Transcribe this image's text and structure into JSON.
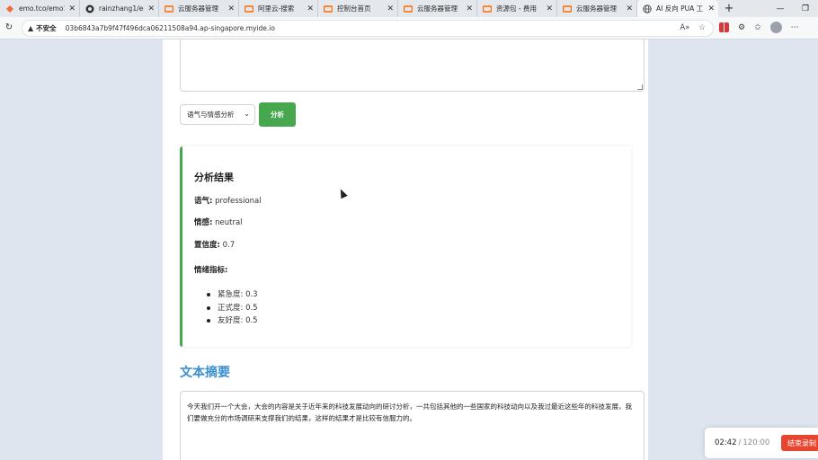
{
  "browser": {
    "tabs": [
      {
        "title": "emo.tco/emo1",
        "icon": "orange-favicon-icon"
      },
      {
        "title": "rainzhang1/em",
        "icon": "github-icon"
      },
      {
        "title": "云服务器管理",
        "icon": "aliyun-icon"
      },
      {
        "title": "阿里云-搜索",
        "icon": "aliyun-icon"
      },
      {
        "title": "控制台首页",
        "icon": "aliyun-icon"
      },
      {
        "title": "云服务器管理",
        "icon": "aliyun-icon"
      },
      {
        "title": "资源包 - 费用",
        "icon": "aliyun-icon"
      },
      {
        "title": "云服务器管理",
        "icon": "aliyun-icon"
      },
      {
        "title": "AI 反向 PUA 工",
        "icon": "globe-icon",
        "active": true
      }
    ],
    "new_tab": "+",
    "address": {
      "security_label": "不安全",
      "url": "03b6843a7b9f47f496dca06211508a94.ap-singapore.myide.io"
    }
  },
  "form": {
    "mode_select": "语气与情感分析",
    "analyze_button": "分析"
  },
  "result": {
    "title": "分析结果",
    "tone_label": "语气:",
    "tone_value": "professional",
    "sentiment_label": "情感:",
    "sentiment_value": "neutral",
    "confidence_label": "置信度:",
    "confidence_value": "0.7",
    "indicators_label": "情绪指标:",
    "indicators": [
      "紧急度: 0.3",
      "正式度: 0.5",
      "友好度: 0.5"
    ]
  },
  "summary": {
    "title": "文本摘要",
    "text": "今天我们开一个大会，大会的内容是关于近年来的科技发展动向的研讨分析，一共包括其他的一些国家的科技动向以及我过最近这些年的科技发展，我们要做充分的市场调研来支撑我们的结果，这样的结果才是比较有信服力的。"
  },
  "recorder": {
    "elapsed": "02:42",
    "separator": "/",
    "total": "120:00",
    "stop_label": "结束录制"
  },
  "colors": {
    "accent_green": "#47a74e",
    "title_blue": "#3a8fd1",
    "record_red": "#e8452f"
  }
}
